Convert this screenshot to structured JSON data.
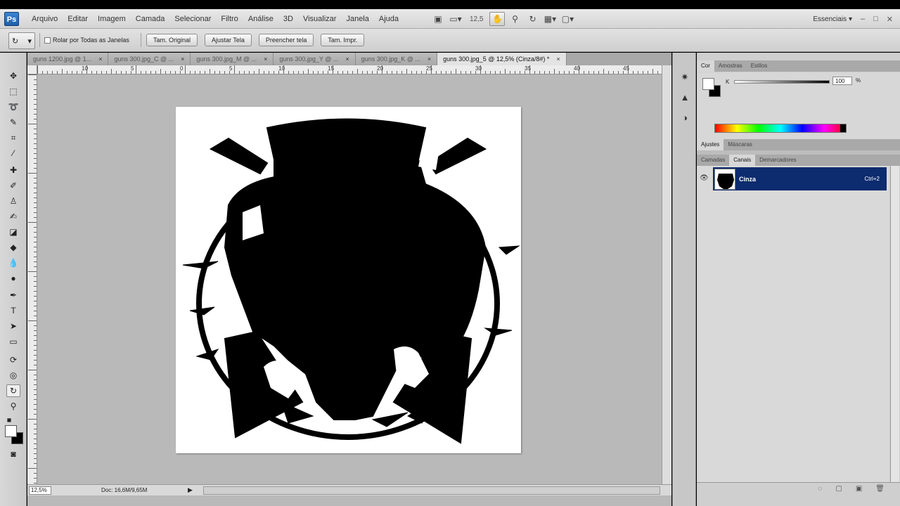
{
  "app": {
    "logo": "Ps",
    "menu": [
      "Arquivo",
      "Editar",
      "Imagem",
      "Camada",
      "Selecionar",
      "Filtro",
      "Análise",
      "3D",
      "Visualizar",
      "Janela",
      "Ajuda"
    ],
    "zoom_select": "12,5",
    "workspace": "Essenciais",
    "workspace_arrow": "▾",
    "win_controls": [
      "–",
      "□",
      "✕"
    ]
  },
  "options": {
    "checkbox_label": "Rolar por Todas as Janelas",
    "buttons": [
      "Tam. Original",
      "Ajustar Tela",
      "Preencher tela",
      "Tam. Impr."
    ]
  },
  "tabs": [
    {
      "label": "guns 1200.jpg @ 1...",
      "active": false
    },
    {
      "label": "guns 300.jpg_C @ ...",
      "active": false
    },
    {
      "label": "guns 300.jpg_M @ ...",
      "active": false
    },
    {
      "label": "guns 300.jpg_Y @ ...",
      "active": false
    },
    {
      "label": "guns 300.jpg_K @ ...",
      "active": false
    },
    {
      "label": "guns 300.jpg_5 @ 12,5% (Cinza/8#) *",
      "active": true
    }
  ],
  "tab_close": "×",
  "ruler_labels": [
    "10",
    "5",
    "0",
    "5",
    "10",
    "15",
    "20",
    "25",
    "30",
    "35",
    "40",
    "45"
  ],
  "status": {
    "zoom": "12,5%",
    "doc": "Doc: 16,6M/9,65M",
    "arrow": "▶"
  },
  "color_panel": {
    "tabs": [
      "Cor",
      "Amostras",
      "Estilos"
    ],
    "channel": "K",
    "value": "100",
    "unit": "%"
  },
  "adjust_tabs": [
    "Ajustes",
    "Máscaras"
  ],
  "channel_tabs": [
    "Camadas",
    "Canais",
    "Demarcadores"
  ],
  "channel": {
    "name": "Cinza",
    "shortcut": "Ctrl+2"
  }
}
